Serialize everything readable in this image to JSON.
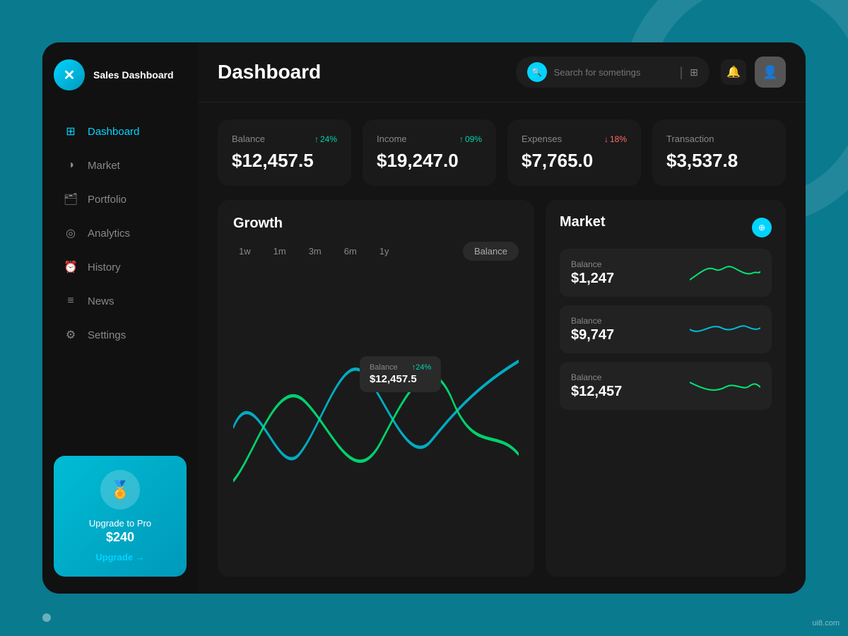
{
  "app": {
    "name": "Sales Dashboard",
    "logo_symbol": "✕"
  },
  "header": {
    "title": "Dashboard",
    "search_placeholder": "Search for sometings"
  },
  "sidebar": {
    "items": [
      {
        "id": "dashboard",
        "label": "Dashboard",
        "icon": "⊞",
        "active": true
      },
      {
        "id": "market",
        "label": "Market",
        "icon": "◑"
      },
      {
        "id": "portfolio",
        "label": "Portfolio",
        "icon": "📁"
      },
      {
        "id": "analytics",
        "label": "Analytics",
        "icon": "◎"
      },
      {
        "id": "history",
        "label": "History",
        "icon": "⏰"
      },
      {
        "id": "news",
        "label": "News",
        "icon": "≡"
      },
      {
        "id": "settings",
        "label": "Settings",
        "icon": "⚙"
      }
    ]
  },
  "upgrade": {
    "title": "Upgrade to Pro",
    "price": "$240",
    "button_label": "Upgrade →"
  },
  "stats": [
    {
      "label": "Balance",
      "value": "$12,457.5",
      "change": "24%",
      "direction": "up"
    },
    {
      "label": "Income",
      "value": "$19,247.0",
      "change": "09%",
      "direction": "up"
    },
    {
      "label": "Expenses",
      "value": "$7,765.0",
      "change": "18%",
      "direction": "down"
    },
    {
      "label": "Transaction",
      "value": "$3,537.8",
      "change": "",
      "direction": ""
    }
  ],
  "growth": {
    "title": "Growth",
    "time_filters": [
      "1w",
      "1m",
      "3m",
      "6m",
      "1y"
    ],
    "balance_filter": "Balance",
    "tooltip": {
      "label": "Balance",
      "change": "↑24%",
      "value": "$12,457.5"
    }
  },
  "market": {
    "title": "Market",
    "items": [
      {
        "label": "Balance",
        "value": "$1,247"
      },
      {
        "label": "Balance",
        "value": "$9,747"
      },
      {
        "label": "Balance",
        "value": "$12,457"
      }
    ]
  }
}
